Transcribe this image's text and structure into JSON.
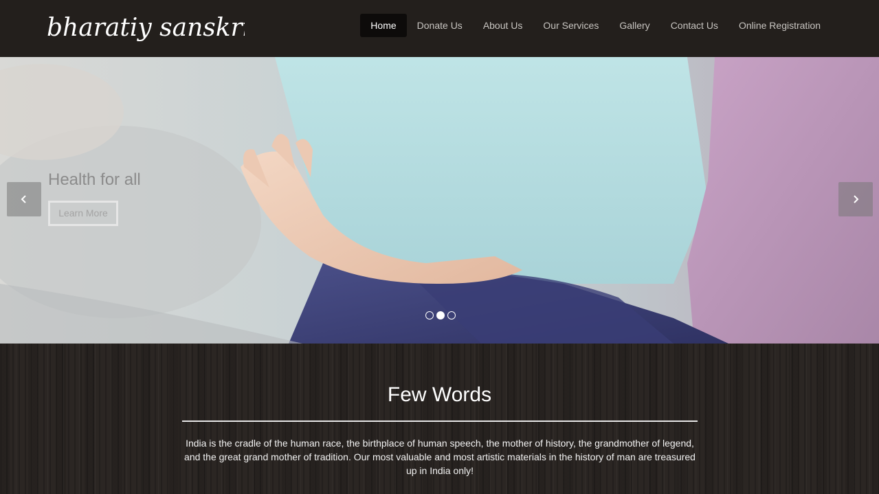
{
  "brand": {
    "logo_text": "bharatiy sanskriti"
  },
  "nav": {
    "items": [
      {
        "label": "Home",
        "active": true
      },
      {
        "label": "Donate Us"
      },
      {
        "label": "About Us"
      },
      {
        "label": "Our Services"
      },
      {
        "label": "Gallery"
      },
      {
        "label": "Contact Us"
      },
      {
        "label": "Online Registration"
      }
    ]
  },
  "hero": {
    "title": "Health for all",
    "button_label": "Learn More",
    "prev_icon": "chevron-left-icon",
    "next_icon": "chevron-right-icon",
    "slide_count": 3,
    "active_slide": 2
  },
  "few_words": {
    "title": "Few Words",
    "text": "India is the cradle of the human race, the birthplace of human speech, the mother of history, the grandmother of legend, and the great grand mother of tradition. Our most valuable and most artistic materials in the history of man are treasured up in India only!"
  },
  "colors": {
    "navbar_bg": "#231f1c",
    "active_nav_bg": "#0d0b0a",
    "nav_text": "#c9c6c2",
    "section_bg": "#2b2623"
  }
}
